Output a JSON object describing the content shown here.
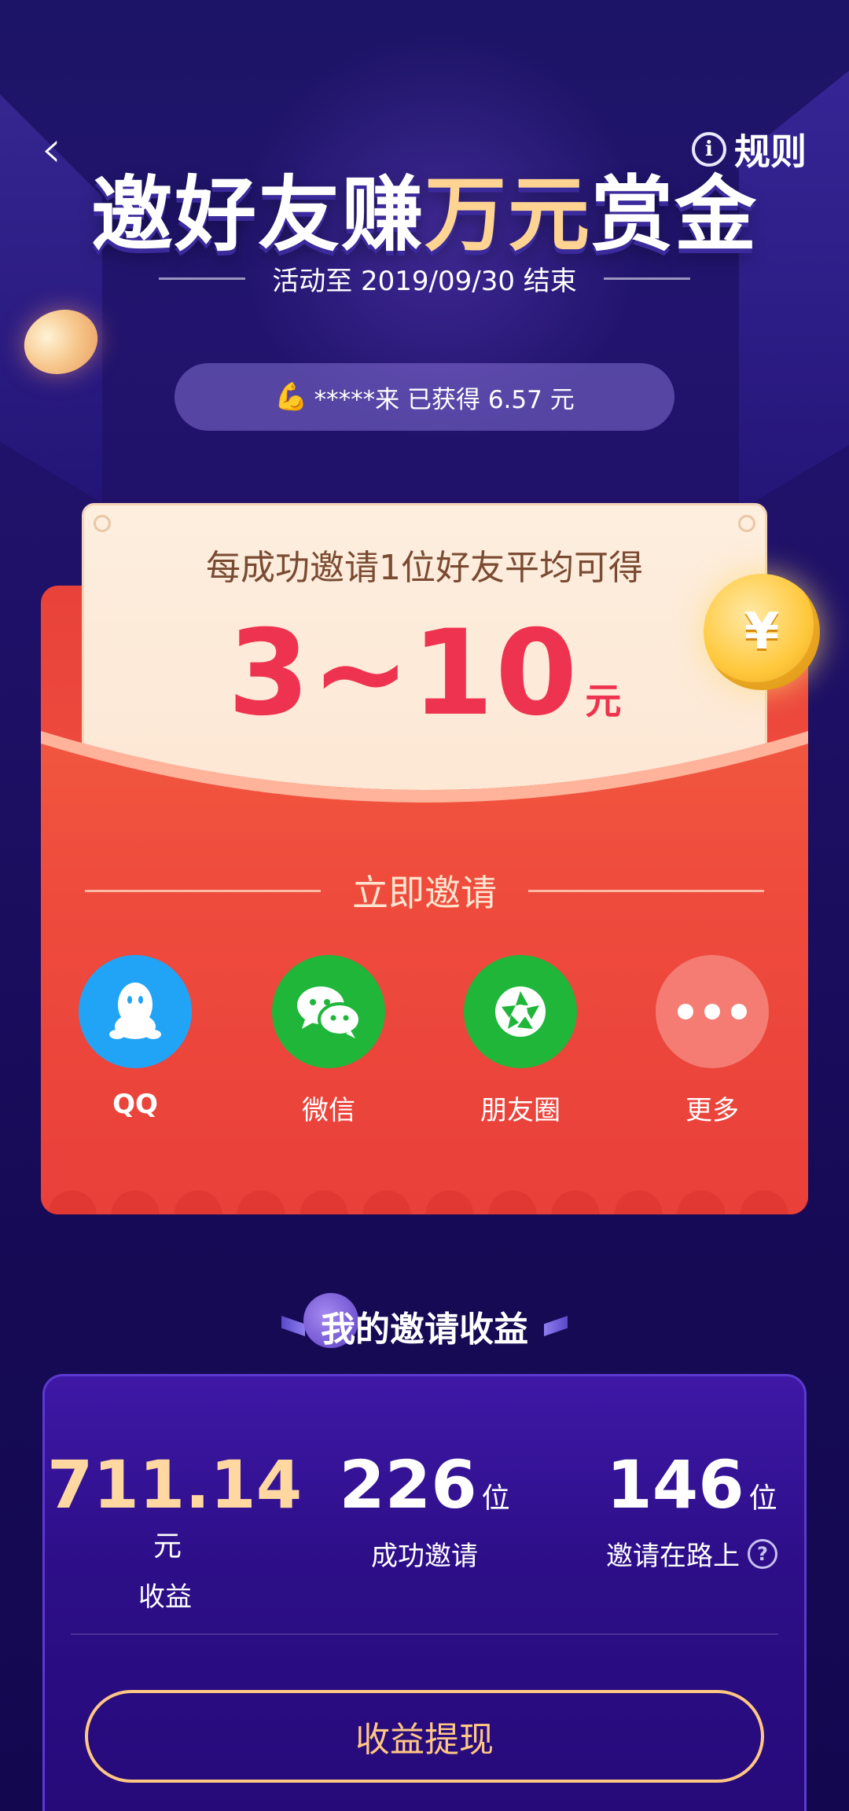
{
  "header": {
    "back_glyph": "‹",
    "rules_label": "规则",
    "title_part1": "邀好友赚",
    "title_part2": "万元",
    "title_part3": "赏金",
    "period_text": "活动至 2019/09/30 结束"
  },
  "ticker": {
    "icon": "💪",
    "text": "*****来 已获得 6.57 元"
  },
  "reward_card": {
    "subtitle": "每成功邀请1位好友平均可得",
    "amount": "3~10",
    "unit": "元",
    "coin_symbol": "¥"
  },
  "invite": {
    "heading": "立即邀请",
    "channels": [
      {
        "label": "QQ",
        "icon": "qq-icon",
        "color": "#21a4f6"
      },
      {
        "label": "微信",
        "icon": "wechat-icon",
        "color": "#1fb63a"
      },
      {
        "label": "朋友圈",
        "icon": "moments-icon",
        "color": "#1fb63a"
      },
      {
        "label": "更多",
        "icon": "more-icon",
        "color": "#f47c72"
      }
    ]
  },
  "earnings": {
    "title": "我的邀请收益",
    "income": {
      "value": "711.14",
      "unit": "元",
      "label": "收益"
    },
    "success": {
      "value": "226",
      "unit": "位",
      "label": "成功邀请"
    },
    "pending": {
      "value": "146",
      "unit": "位",
      "label": "邀请在路上"
    },
    "help_glyph": "?",
    "withdraw_label": "收益提现"
  },
  "colors": {
    "background": "#1c1466",
    "envelope_red": "#ee3d35",
    "amount_red": "#ee3350",
    "gold": "#ffd392",
    "button_gold": "#ffc783"
  }
}
